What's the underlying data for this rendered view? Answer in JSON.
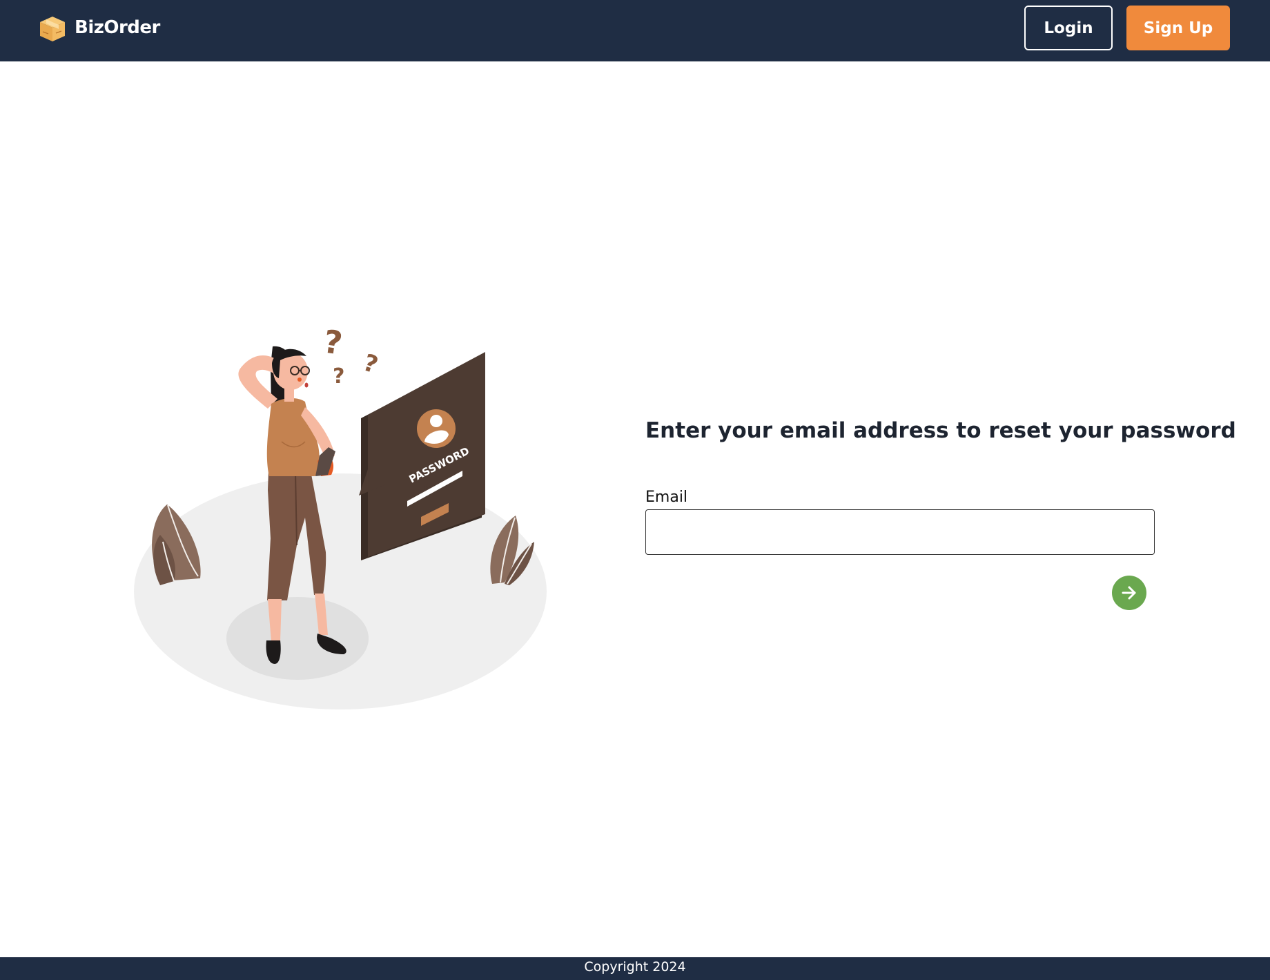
{
  "header": {
    "brand_name": "BizOrder",
    "logo_icon": "box-icon",
    "login_label": "Login",
    "signup_label": "Sign Up"
  },
  "illustration": {
    "password_card_text": "PASSWORD",
    "password_mask": "* * *"
  },
  "reset_form": {
    "title": "Enter your email address to reset your password",
    "email_label": "Email",
    "email_value": "",
    "submit_icon": "arrow-right-icon"
  },
  "footer": {
    "copyright": "Copyright 2024"
  },
  "colors": {
    "navbar_bg": "#1f2d44",
    "signup_bg": "#f08a3c",
    "submit_bg": "#6aa84f",
    "illustration_brown": "#4d3b32",
    "illustration_tan": "#c48250"
  }
}
